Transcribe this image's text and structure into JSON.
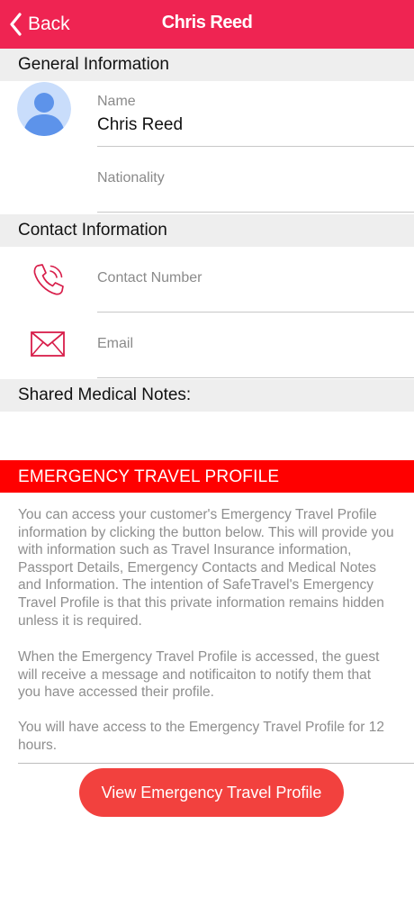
{
  "nav": {
    "back_label": "Back",
    "title": "Chris Reed"
  },
  "general": {
    "header": "General Information",
    "name_label": "Name",
    "name_value": "Chris Reed",
    "nationality_label": "Nationality",
    "nationality_value": ""
  },
  "contact": {
    "header": "Contact Information",
    "phone_placeholder": "Contact Number",
    "email_placeholder": "Email"
  },
  "medical": {
    "header": "Shared Medical Notes:",
    "notes": ""
  },
  "emergency": {
    "header": "EMERGENCY TRAVEL PROFILE",
    "paragraphs": [
      "You can access your customer's Emergency Travel Profile information by clicking the button below. This will provide you with information such as Travel Insurance information, Passport Details, Emergency Contacts and Medical Notes and Information. The intention of SafeTravel's Emergency Travel Profile is that this private information remains hidden unless it is required.",
      "When the Emergency Travel Profile is accessed, the guest will receive a message and notificaiton to notify them that you have accessed their profile.",
      "You will have access to the Emergency Travel Profile for 12 hours."
    ],
    "button_label": "View Emergency Travel Profile"
  },
  "icons": {
    "back": "chevron-left-icon",
    "avatar": "user-avatar-icon",
    "phone": "phone-icon",
    "email": "envelope-icon"
  },
  "colors": {
    "nav_bar": "#ef2452",
    "emergency_bar": "#ff0000",
    "button": "#f2413e",
    "icon_accent": "#d81e4a",
    "section_bg": "#eeeeee",
    "avatar_bg": "#c9ddfb",
    "avatar_fg": "#5d93ea"
  }
}
